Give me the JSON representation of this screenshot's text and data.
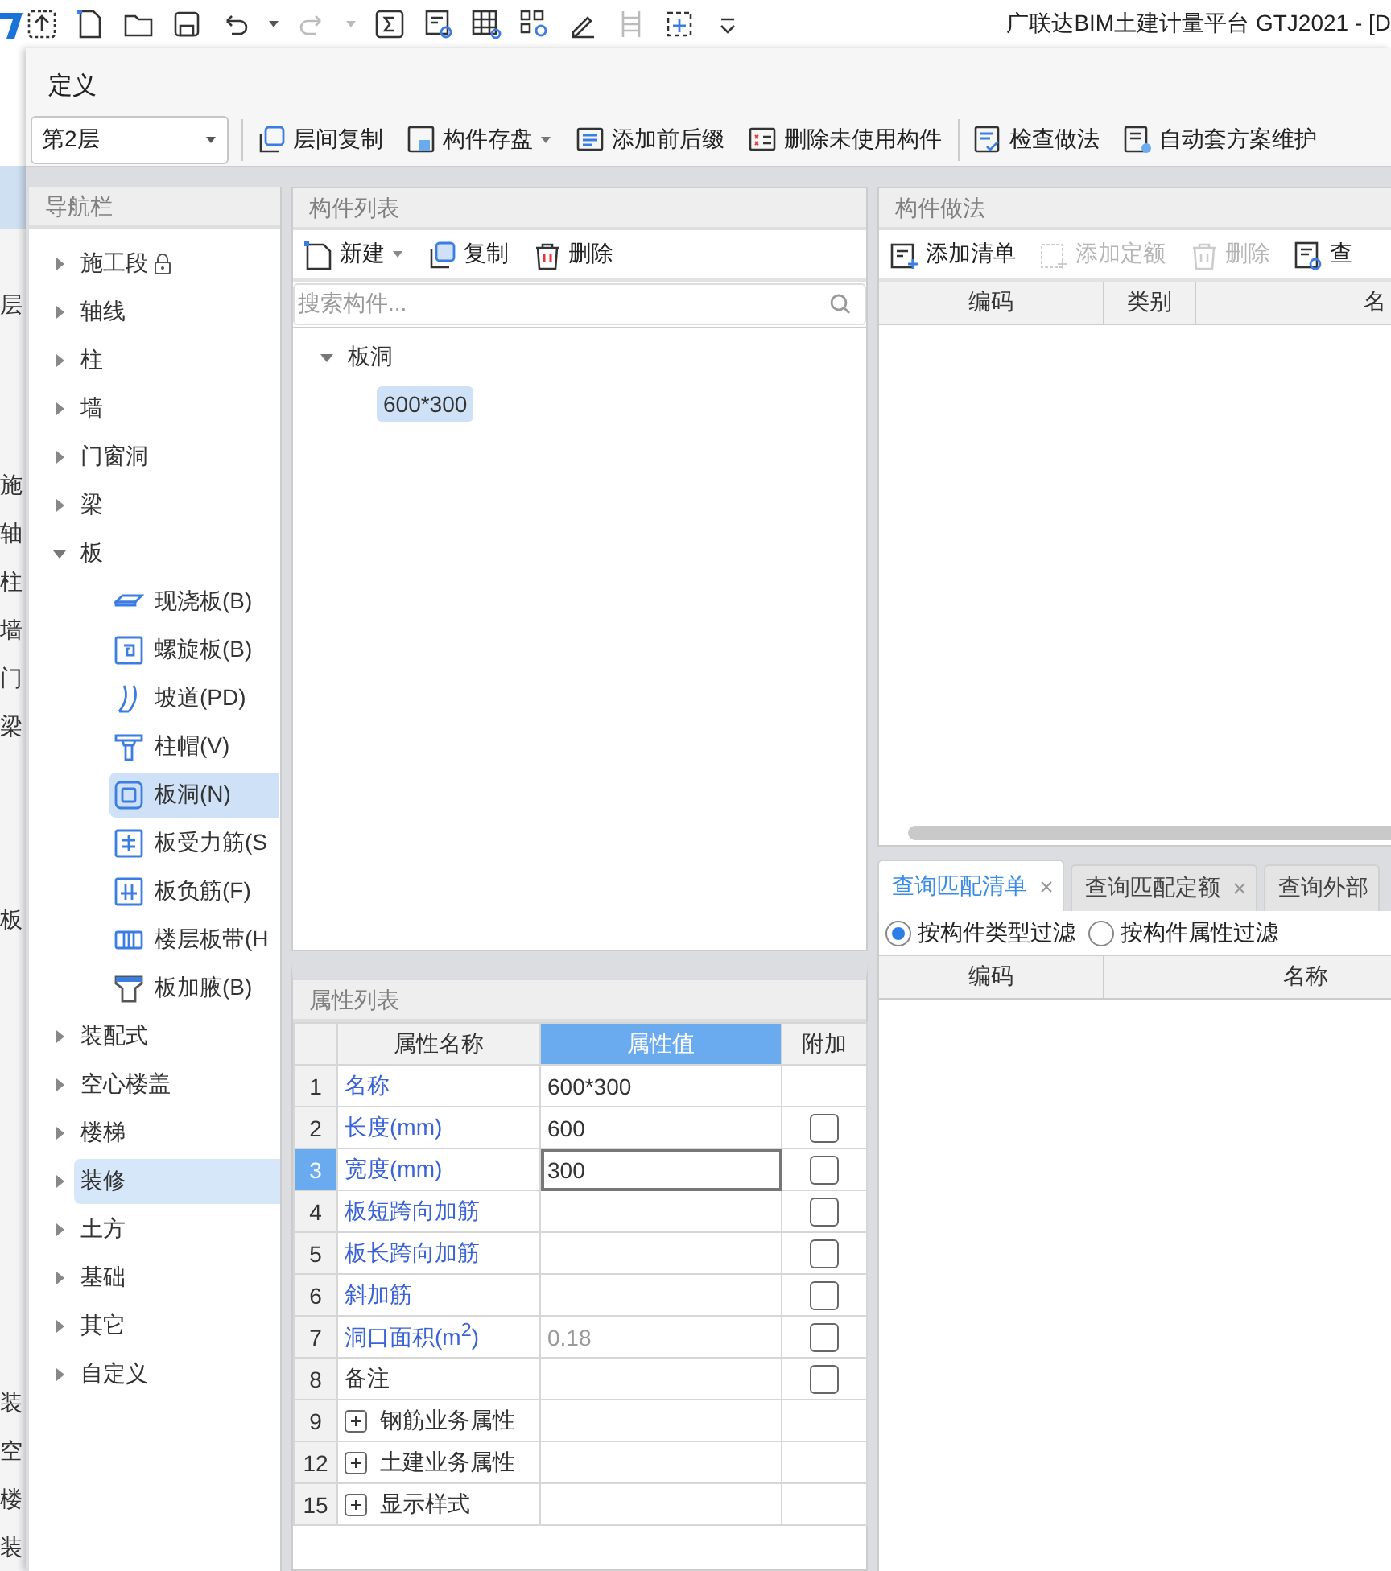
{
  "app_title": "广联达BIM土建计量平台 GTJ2021 - [D",
  "background_window": {
    "groups": [
      [
        "层"
      ],
      [
        "施",
        "轴",
        "柱",
        "墙",
        "门",
        "梁"
      ],
      [
        "板"
      ],
      [
        "装",
        "空",
        "楼",
        "装"
      ]
    ]
  },
  "dialog": {
    "title": "定义",
    "floor_select": {
      "value": "第2层"
    },
    "toolbar_groups": [
      [
        {
          "label": "层间复制",
          "dropdown": false
        },
        {
          "label": "构件存盘",
          "dropdown": true
        },
        {
          "label": "添加前后缀",
          "dropdown": false
        },
        {
          "label": "删除未使用构件",
          "dropdown": false
        }
      ],
      [
        {
          "label": "检查做法",
          "dropdown": false
        },
        {
          "label": "自动套方案维护",
          "dropdown": false
        }
      ]
    ]
  },
  "navigation": {
    "title": "导航栏",
    "items": [
      {
        "label": "施工段",
        "expanded": false,
        "locked": true,
        "highlighted": false
      },
      {
        "label": "轴线",
        "expanded": false,
        "locked": false,
        "highlighted": false
      },
      {
        "label": "柱",
        "expanded": false,
        "locked": false,
        "highlighted": false
      },
      {
        "label": "墙",
        "expanded": false,
        "locked": false,
        "highlighted": false
      },
      {
        "label": "门窗洞",
        "expanded": false,
        "locked": false,
        "highlighted": false
      },
      {
        "label": "梁",
        "expanded": false,
        "locked": false,
        "highlighted": false
      },
      {
        "label": "板",
        "expanded": true,
        "locked": false,
        "highlighted": false,
        "children": [
          {
            "label": "现浇板(B)",
            "selected": false
          },
          {
            "label": "螺旋板(B)",
            "selected": false
          },
          {
            "label": "坡道(PD)",
            "selected": false
          },
          {
            "label": "柱帽(V)",
            "selected": false
          },
          {
            "label": "板洞(N)",
            "selected": true
          },
          {
            "label": "板受力筋(S",
            "selected": false
          },
          {
            "label": "板负筋(F)",
            "selected": false
          },
          {
            "label": "楼层板带(H",
            "selected": false
          },
          {
            "label": "板加腋(B)",
            "selected": false
          }
        ]
      },
      {
        "label": "装配式",
        "expanded": false,
        "locked": false,
        "highlighted": false
      },
      {
        "label": "空心楼盖",
        "expanded": false,
        "locked": false,
        "highlighted": false
      },
      {
        "label": "楼梯",
        "expanded": false,
        "locked": false,
        "highlighted": false
      },
      {
        "label": "装修",
        "expanded": false,
        "locked": false,
        "highlighted": true
      },
      {
        "label": "土方",
        "expanded": false,
        "locked": false,
        "highlighted": false
      },
      {
        "label": "基础",
        "expanded": false,
        "locked": false,
        "highlighted": false
      },
      {
        "label": "其它",
        "expanded": false,
        "locked": false,
        "highlighted": false
      },
      {
        "label": "自定义",
        "expanded": false,
        "locked": false,
        "highlighted": false
      }
    ]
  },
  "component_list": {
    "title": "构件列表",
    "toolbar": [
      {
        "label": "新建",
        "dropdown": true
      },
      {
        "label": "复制",
        "dropdown": false
      },
      {
        "label": "删除",
        "dropdown": false
      }
    ],
    "search": {
      "placeholder": "搜索构件..."
    },
    "tree": [
      {
        "label": "板洞",
        "expanded": true,
        "children": [
          {
            "label": "600*300",
            "selected": true
          }
        ]
      }
    ]
  },
  "properties": {
    "title": "属性列表",
    "columns": [
      "属性名称",
      "属性值",
      "附加"
    ],
    "rows": [
      {
        "kind": "field",
        "num": "1",
        "name": "名称",
        "value": "600*300",
        "public": true,
        "readonly": false,
        "selected": false
      },
      {
        "kind": "field",
        "num": "2",
        "name": "长度(mm)",
        "value": "600",
        "public": true,
        "readonly": false,
        "selected": false,
        "checked": false
      },
      {
        "kind": "field",
        "num": "3",
        "name": "宽度(mm)",
        "value": "300",
        "public": true,
        "readonly": false,
        "selected": true,
        "checked": false
      },
      {
        "kind": "field",
        "num": "4",
        "name": "板短跨向加筋",
        "public": true,
        "selected": false,
        "checked": false
      },
      {
        "kind": "field",
        "num": "5",
        "name": "板长跨向加筋",
        "public": true,
        "selected": false,
        "checked": false
      },
      {
        "kind": "field",
        "num": "6",
        "name": "斜加筋",
        "public": true,
        "selected": false,
        "checked": false
      },
      {
        "kind": "field",
        "num": "7",
        "name": "洞口面积(m$^{2}$)",
        "value": "0.18",
        "public": true,
        "readonly": true,
        "selected": false,
        "checked": false
      },
      {
        "kind": "field",
        "num": "8",
        "name": "备注",
        "public": false,
        "selected": false,
        "checked": false
      },
      {
        "kind": "group",
        "num": "9",
        "name": "钢筋业务属性",
        "expanded": false,
        "selected": false
      },
      {
        "kind": "group",
        "num": "12",
        "name": "土建业务属性",
        "expanded": false,
        "selected": false
      },
      {
        "kind": "group",
        "num": "15",
        "name": "显示样式",
        "expanded": false,
        "selected": false
      }
    ]
  },
  "methods": {
    "title": "构件做法",
    "toolbar": [
      {
        "label": "添加清单",
        "disabled": false
      },
      {
        "label": "添加定额",
        "disabled": true
      },
      {
        "label": "删除",
        "disabled": true
      },
      {
        "label": "查",
        "disabled": false
      }
    ],
    "columns": [
      "编码",
      "类别",
      "名"
    ],
    "query_tabs": [
      {
        "label": "查询匹配清单",
        "selected": true,
        "closable": true
      },
      {
        "label": "查询匹配定额",
        "selected": false,
        "closable": true
      },
      {
        "label": "查询外部",
        "selected": false,
        "closable": false
      }
    ],
    "filters": [
      {
        "label": "按构件类型过滤",
        "selected": true
      },
      {
        "label": "按构件属性过滤",
        "selected": false
      }
    ],
    "query_columns": [
      "编码",
      "名称"
    ]
  }
}
